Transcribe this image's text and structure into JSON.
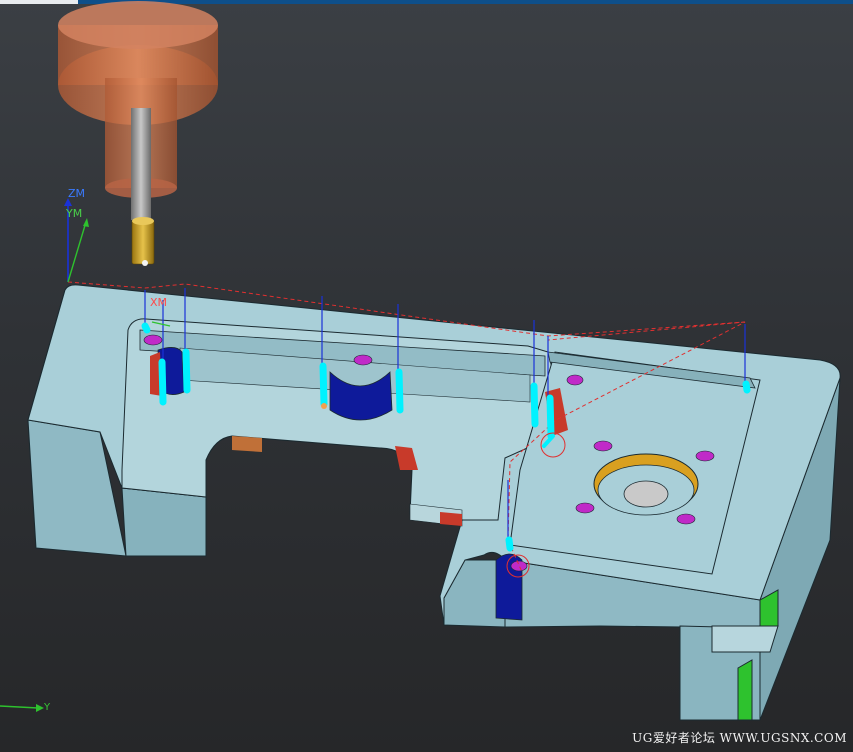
{
  "axes": {
    "zm_label": "ZM",
    "ym_label": "YM",
    "xm_label": "XM",
    "y_label": "Y"
  },
  "watermark": "UG爱好者论坛 WWW.UGSNX.COM",
  "colors": {
    "part_top": "#a9cfd8",
    "part_side": "#8fb9c4",
    "tool_holder": "#c8714a",
    "tool_tip": "#c8a020",
    "toolpath_cyan": "#00f2ff",
    "toolpath_blue": "#1a32d8",
    "toolpath_red_dashed": "#e03030",
    "hole_magenta": "#c02ac8",
    "wall_blue": "#0e1a9a",
    "wall_red": "#c83a2a",
    "face_green": "#2ec22e",
    "bore_orange": "#d9a020"
  }
}
